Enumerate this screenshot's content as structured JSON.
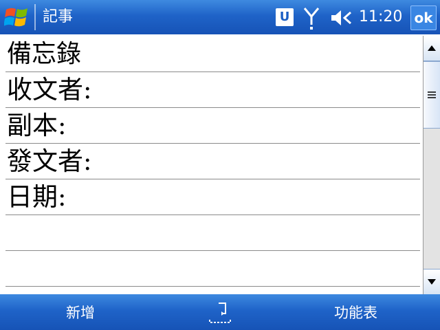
{
  "titlebar": {
    "app_title": "記事",
    "status": {
      "u_badge": "U",
      "time": "11:20",
      "ok_label": "ok"
    }
  },
  "note": {
    "lines": [
      "備忘錄",
      "收文者:",
      "副本:",
      "發文者:",
      "日期:",
      "",
      ""
    ]
  },
  "softbar": {
    "left_label": "新增",
    "right_label": "功能表"
  },
  "icons": [
    "windows-start-icon",
    "u-badge-icon",
    "antenna-icon",
    "volume-icon",
    "keyboard-sip-icon",
    "scroll-up-icon",
    "scroll-down-icon",
    "scroll-grip-icon"
  ],
  "colors": {
    "bar_blue": "#1f63c8",
    "bar_blue_light": "#3e8ae0",
    "rule_gray": "#8a8a8a"
  }
}
